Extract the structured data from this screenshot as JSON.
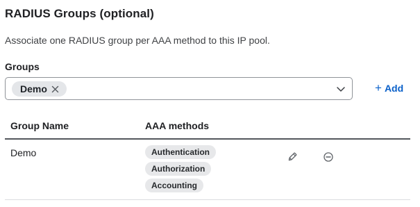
{
  "section": {
    "title": "RADIUS Groups (optional)",
    "description": "Associate one RADIUS group per AAA method to this IP pool."
  },
  "groups_field": {
    "label": "Groups",
    "selected_chips": [
      "Demo"
    ],
    "chip_remove_icon": "close-icon",
    "dropdown_icon": "chevron-down-icon"
  },
  "add_button": {
    "icon": "plus-icon",
    "plus_glyph": "+",
    "label": "Add"
  },
  "table": {
    "columns": [
      "Group Name",
      "AAA methods"
    ],
    "rows": [
      {
        "group_name": "Demo",
        "aaa_methods": [
          "Authentication",
          "Authorization",
          "Accounting"
        ],
        "actions": [
          "pencil-icon",
          "minus-circle-icon"
        ]
      }
    ]
  },
  "colors": {
    "accent": "#0a60c9",
    "tag_background": "#e7e8ea",
    "border": "#8f9398"
  }
}
